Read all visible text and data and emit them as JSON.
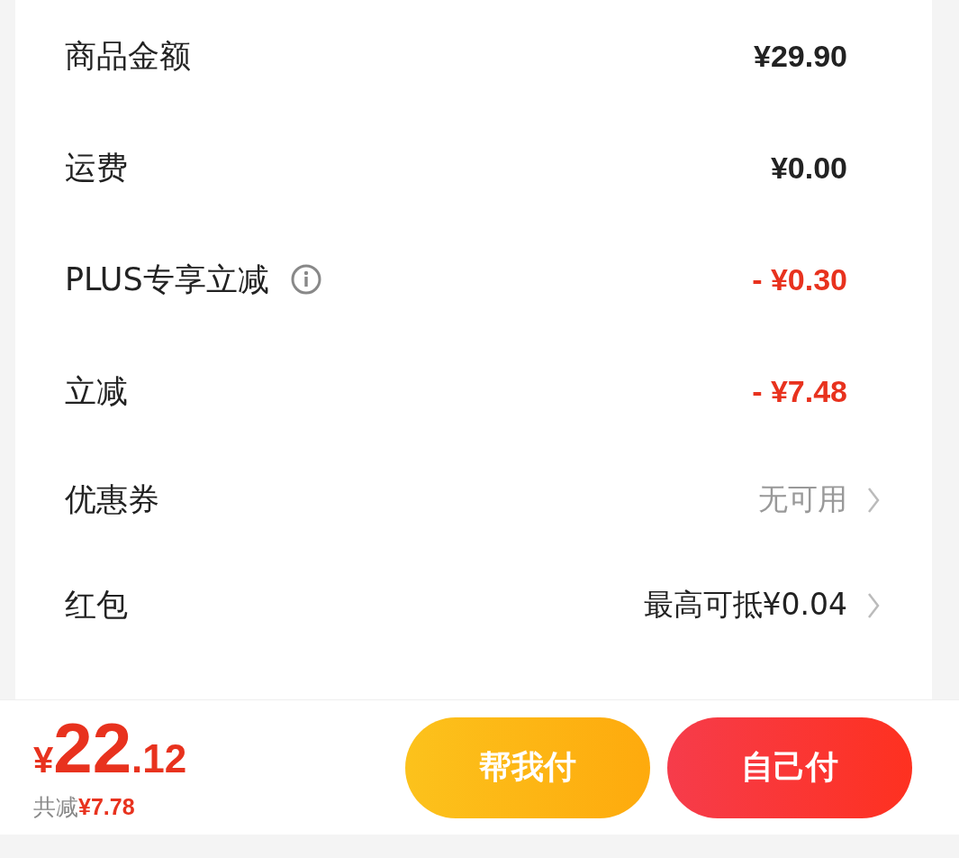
{
  "fees": [
    {
      "label": "商品金额",
      "value": "¥29.90",
      "kind": "plain"
    },
    {
      "label": "运费",
      "value": "¥0.00",
      "kind": "plain"
    },
    {
      "label": "PLUS专享立减",
      "value": "- ¥0.30",
      "kind": "discount",
      "info": true
    },
    {
      "label": "立减",
      "value": "- ¥7.48",
      "kind": "discount"
    },
    {
      "label": "优惠券",
      "value": "无可用",
      "kind": "link",
      "muted": true
    },
    {
      "label": "红包",
      "value": "最高可抵¥0.04",
      "kind": "link",
      "muted": false
    }
  ],
  "total": {
    "currency": "¥",
    "integer": "22",
    "decimal": ".12",
    "savings_label": "共减",
    "savings_amount": "¥7.78"
  },
  "buttons": [
    {
      "label": "帮我付",
      "kind": "secondary"
    },
    {
      "label": "自己付",
      "kind": "primary"
    }
  ]
}
